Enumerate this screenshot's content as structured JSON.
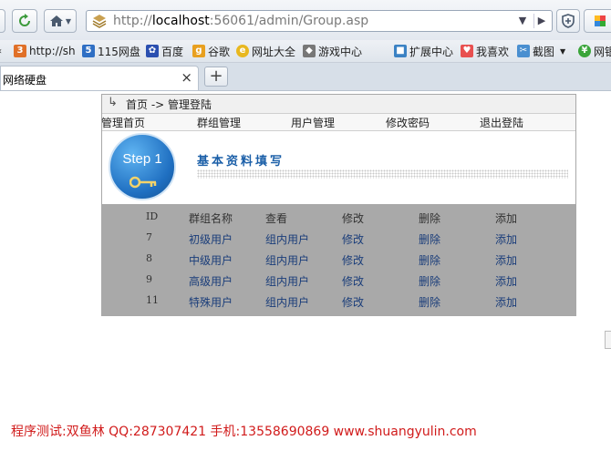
{
  "browser": {
    "url_prefix": "http://",
    "url_host": "localhost",
    "url_rest": ":56061/admin/Group.asp",
    "bookmarks": [
      "http://sh",
      "115网盘",
      "百度",
      "谷歌",
      "网址大全",
      "游戏中心",
      "扩展中心",
      "我喜欢",
      "截图",
      "网银"
    ],
    "tab_title": "网络硬盘",
    "tab_close": "×",
    "new_tab": "+"
  },
  "page": {
    "breadcrumb": {
      "arrow": "↳",
      "text": "首页 -> 管理登陆"
    },
    "menu": [
      "管理首页",
      "群组管理",
      "用户管理",
      "修改密码",
      "退出登陆"
    ],
    "step": {
      "label": "Step 1",
      "title": "基本资料填写"
    },
    "table": {
      "headers": [
        "ID",
        "群组名称",
        "查看",
        "修改",
        "删除",
        "添加"
      ],
      "rows": [
        [
          "7",
          "初级用户",
          "组内用户",
          "修改",
          "删除",
          "添加"
        ],
        [
          "8",
          "中级用户",
          "组内用户",
          "修改",
          "删除",
          "添加"
        ],
        [
          "9",
          "高级用户",
          "组内用户",
          "修改",
          "删除",
          "添加"
        ],
        [
          "11",
          "特殊用户",
          "组内用户",
          "修改",
          "删除",
          "添加"
        ]
      ]
    }
  },
  "footer": "程序测试:双鱼林 QQ:287307421 手机:13558690869 www.shuangyulin.com",
  "colors": {
    "link": "#1a3d7a",
    "grid_bg": "#a9a9a9",
    "footer": "#d11b1b",
    "step_title": "#1b5fa8"
  }
}
